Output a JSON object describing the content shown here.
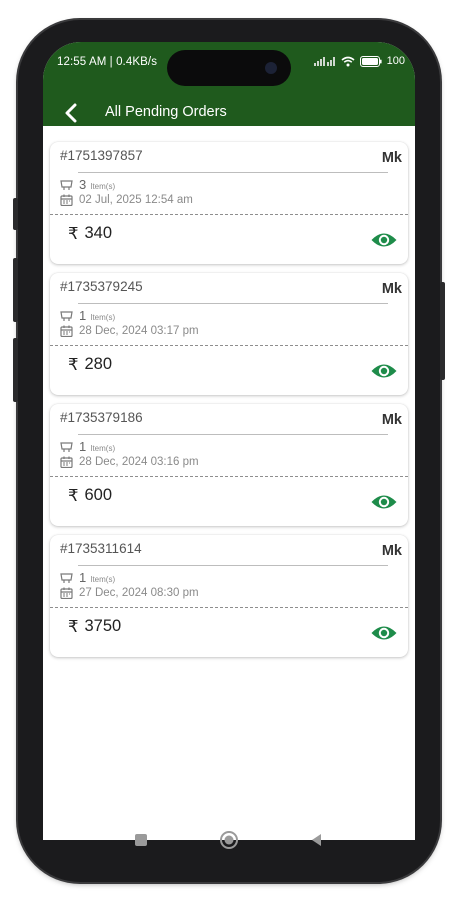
{
  "status_bar": {
    "time_info": "12:55 AM | 0.4KB/s",
    "battery": "100"
  },
  "header": {
    "title": "All Pending Orders"
  },
  "orders": [
    {
      "id": "#1751397857",
      "customer": "Mk",
      "items_count": "3",
      "items_label": "Item(s)",
      "date": "02 Jul, 2025 12:54 am",
      "currency": "₹",
      "amount": "340"
    },
    {
      "id": "#1735379245",
      "customer": "Mk",
      "items_count": "1",
      "items_label": "Item(s)",
      "date": "28 Dec, 2024 03:17 pm",
      "currency": "₹",
      "amount": "280"
    },
    {
      "id": "#1735379186",
      "customer": "Mk",
      "items_count": "1",
      "items_label": "Item(s)",
      "date": "28 Dec, 2024 03:16 pm",
      "currency": "₹",
      "amount": "600"
    },
    {
      "id": "#1735311614",
      "customer": "Mk",
      "items_count": "1",
      "items_label": "Item(s)",
      "date": "27 Dec, 2024 08:30 pm",
      "currency": "₹",
      "amount": "3750"
    }
  ],
  "colors": {
    "header_green": "#1f5a1d",
    "eye_green": "#1e8c4a"
  },
  "icons": {
    "back": "arrow-left-icon",
    "items": "basket-icon",
    "date": "calendar-icon",
    "view": "eye-icon",
    "nav_recent": "square-icon",
    "nav_home": "circle-icon",
    "nav_back": "triangle-icon"
  }
}
